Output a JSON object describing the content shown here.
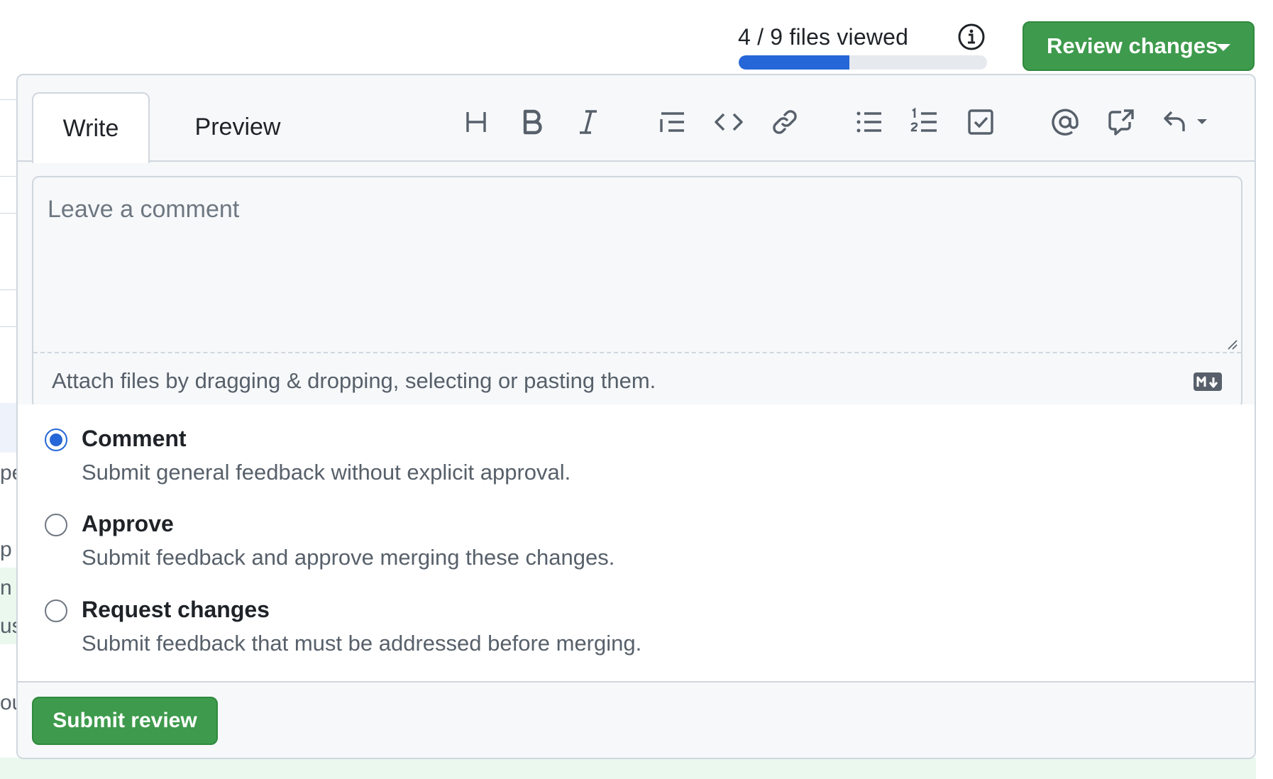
{
  "progress": {
    "label": "4 / 9 files viewed",
    "viewed": 4,
    "total": 9
  },
  "review_button": {
    "label": "Review changes"
  },
  "tabs": [
    {
      "label": "Write",
      "active": true
    },
    {
      "label": "Preview",
      "active": false
    }
  ],
  "toolbar": [
    "heading-icon",
    "bold-icon",
    "italic-icon",
    "quote-icon",
    "code-icon",
    "link-icon",
    "unordered-list-icon",
    "ordered-list-icon",
    "task-list-icon",
    "mention-icon",
    "cross-reference-icon",
    "saved-reply-icon"
  ],
  "comment": {
    "placeholder": "Leave a comment",
    "value": "",
    "attach_hint": "Attach files by dragging & dropping, selecting or pasting them."
  },
  "options": [
    {
      "title": "Comment",
      "desc": "Submit general feedback without explicit approval.",
      "checked": true
    },
    {
      "title": "Approve",
      "desc": "Submit feedback and approve merging these changes.",
      "checked": false
    },
    {
      "title": "Request changes",
      "desc": "Submit feedback that must be addressed before merging.",
      "checked": false
    }
  ],
  "submit": {
    "label": "Submit review"
  },
  "background_fragments": [
    "pe",
    "p",
    "n",
    "us",
    "ou"
  ],
  "colors": {
    "accent": "#2566d8",
    "primary_button": "#3e9a4c",
    "border": "#d0d7de",
    "muted_text": "#57606a"
  }
}
